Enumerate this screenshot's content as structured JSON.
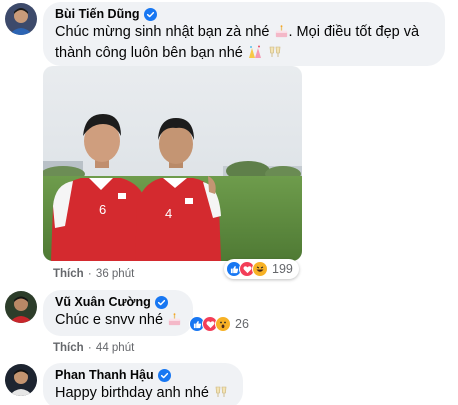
{
  "comments": [
    {
      "author": "Bùi Tiến Dũng",
      "text_line1": "Chúc mừng sinh nhật bạn zà nhé",
      "text_line1b": ". Mọi điều tốt đẹp và",
      "text_line2": "thành công luôn bên bạn nhé",
      "like_label": "Thích",
      "time": "36 phút",
      "reaction_count": "199",
      "reactions": [
        "like-icon",
        "love-icon",
        "haha-icon"
      ],
      "photo_jersey_left": "6",
      "photo_jersey_right": "4"
    },
    {
      "author": "Vũ Xuân Cường",
      "text": "Chúc e snvv nhé",
      "like_label": "Thích",
      "time": "44 phút",
      "reaction_count": "26",
      "reactions": [
        "like-icon",
        "love-icon",
        "wow-icon"
      ]
    },
    {
      "author": "Phan Thanh Hậu",
      "text": "Happy birthday anh nhé"
    }
  ],
  "colors": {
    "bubble": "#f0f2f5",
    "verified": "#1877f2",
    "like": "#1877f2",
    "love": "#f33e58",
    "haha": "#f7b125",
    "meta_text": "#65676b"
  }
}
